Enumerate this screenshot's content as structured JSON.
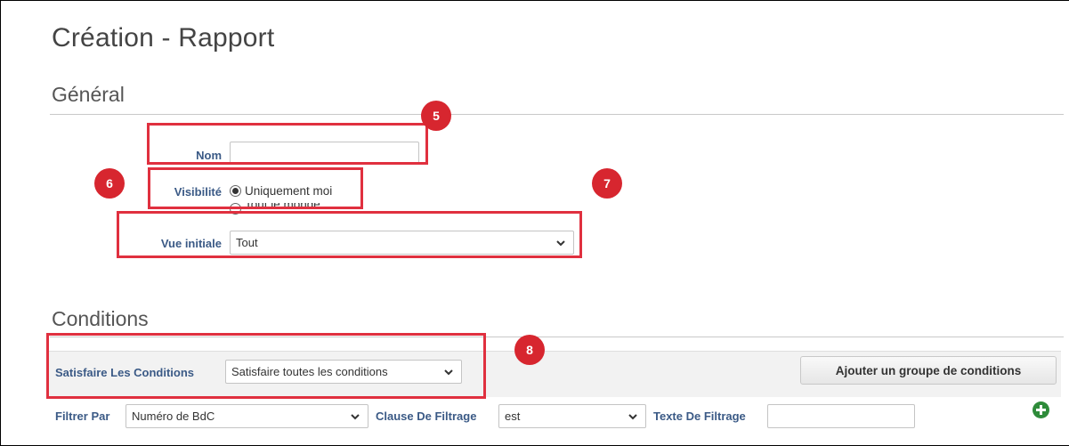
{
  "page": {
    "title": "Création - Rapport"
  },
  "general": {
    "title": "Général",
    "name_label": "Nom",
    "name_value": "",
    "visibility_label": "Visibilité",
    "visibility_options": [
      "Uniquement moi",
      "Tout le monde"
    ],
    "visibility_selected": "Uniquement moi",
    "initial_view_label": "Vue initiale",
    "initial_view_value": "Tout"
  },
  "conditions": {
    "title": "Conditions",
    "satisfy_label": "Satisfaire Les Conditions",
    "satisfy_value": "Satisfaire toutes les conditions",
    "add_group_button": "Ajouter un groupe de conditions",
    "filter_by_label": "Filtrer Par",
    "filter_by_value": "Numéro de BdC",
    "filter_clause_label": "Clause De Filtrage",
    "filter_clause_value": "est",
    "filter_text_label": "Texte De Filtrage",
    "filter_text_value": ""
  },
  "annotations": {
    "steps": [
      "5",
      "6",
      "7",
      "8"
    ],
    "color": "#d7262f"
  },
  "icons": {
    "dropdown": "chevron-down-icon",
    "add": "plus-circle-icon"
  }
}
